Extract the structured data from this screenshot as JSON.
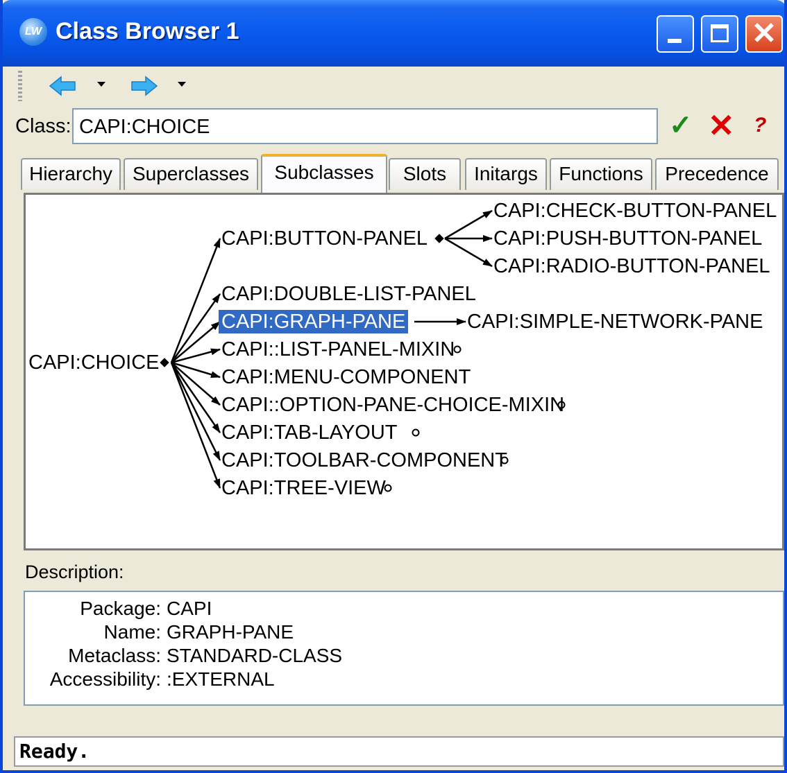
{
  "window": {
    "title": "Class Browser 1",
    "icon": "lw-app-icon",
    "app_icon_text": "LW"
  },
  "toolbar": {
    "back_icon": "back-arrow-icon",
    "forward_icon": "forward-arrow-icon"
  },
  "class_field": {
    "label": "Class:",
    "value": "CAPI:CHOICE"
  },
  "tabs": [
    {
      "label": "Hierarchy",
      "active": false
    },
    {
      "label": "Superclasses",
      "active": false
    },
    {
      "label": "Subclasses",
      "active": true
    },
    {
      "label": "Slots",
      "active": false
    },
    {
      "label": "Initargs",
      "active": false
    },
    {
      "label": "Functions",
      "active": false
    },
    {
      "label": "Precedence",
      "active": false
    }
  ],
  "graph": {
    "root": "CAPI:CHOICE",
    "children": [
      "CAPI:BUTTON-PANEL",
      "CAPI:DOUBLE-LIST-PANEL",
      "CAPI:GRAPH-PANE",
      "CAPI::LIST-PANEL-MIXIN",
      "CAPI:MENU-COMPONENT",
      "CAPI::OPTION-PANE-CHOICE-MIXIN",
      "CAPI:TAB-LAYOUT",
      "CAPI:TOOLBAR-COMPONENT",
      "CAPI:TREE-VIEW"
    ],
    "button_panel_children": [
      "CAPI:CHECK-BUTTON-PANEL",
      "CAPI:PUSH-BUTTON-PANEL",
      "CAPI:RADIO-BUTTON-PANEL"
    ],
    "graph_pane_children": [
      "CAPI:SIMPLE-NETWORK-PANE"
    ],
    "selected": "CAPI:GRAPH-PANE"
  },
  "description": {
    "label": "Description:",
    "rows": [
      {
        "key": "Package:",
        "value": "CAPI"
      },
      {
        "key": "Name:",
        "value": "GRAPH-PANE"
      },
      {
        "key": "Metaclass:",
        "value": "STANDARD-CLASS"
      },
      {
        "key": "Accessibility:",
        "value": ":EXTERNAL"
      }
    ]
  },
  "status": {
    "text": "Ready."
  },
  "colors": {
    "title_bar": "#0a5cf0",
    "selection": "#316ac5",
    "accept_icon": "#1a8a1a",
    "cancel_icon": "#e00000"
  }
}
